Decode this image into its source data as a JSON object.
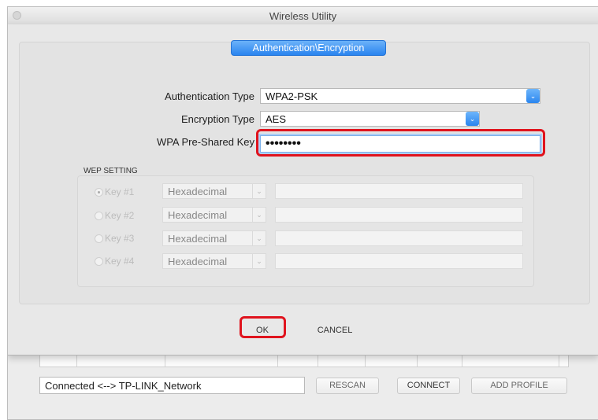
{
  "window": {
    "title": "Wireless Utility"
  },
  "sheet": {
    "tab_label": "Authentication\\Encryption",
    "auth_type_label": "Authentication Type",
    "auth_type_value": "WPA2-PSK",
    "enc_type_label": "Encryption Type",
    "enc_type_value": "AES",
    "psk_label": "WPA Pre-Shared Key",
    "psk_value": "••••••••",
    "wep_title": "WEP SETTING",
    "wep_keys": [
      {
        "label": "Key #1",
        "format": "Hexadecimal",
        "selected": true
      },
      {
        "label": "Key #2",
        "format": "Hexadecimal",
        "selected": false
      },
      {
        "label": "Key #3",
        "format": "Hexadecimal",
        "selected": false
      },
      {
        "label": "Key #4",
        "format": "Hexadecimal",
        "selected": false
      }
    ],
    "ok_label": "OK",
    "cancel_label": "CANCEL"
  },
  "main": {
    "status_text": "Connected <--> TP-LINK_Network",
    "rescan_label": "RESCAN",
    "connect_label": "CONNECT",
    "add_profile_label": "ADD PROFILE"
  },
  "colors": {
    "accent": "#2a84ef",
    "highlight": "#e0141e"
  },
  "icons": {
    "dropdown": "chevron-down-icon"
  }
}
